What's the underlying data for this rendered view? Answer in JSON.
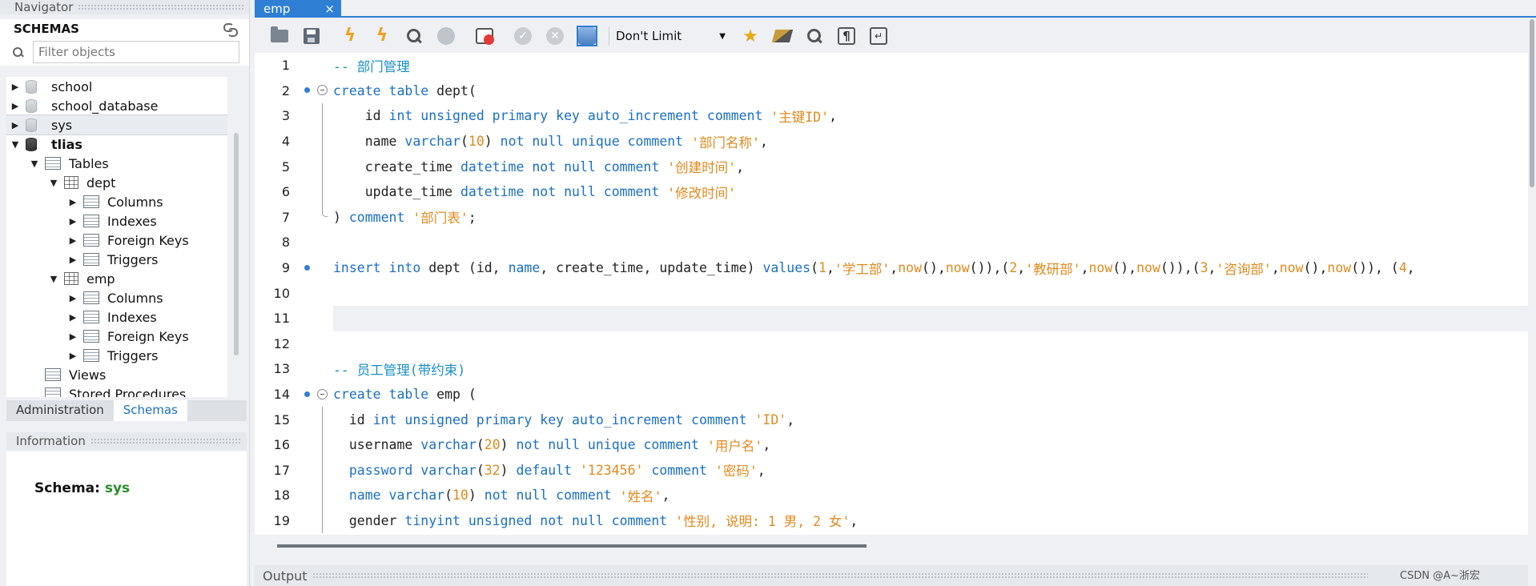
{
  "navigator": {
    "title": "Navigator",
    "schemas_title": "SCHEMAS",
    "filter_placeholder": "Filter objects",
    "tree": [
      {
        "label": "school",
        "level": 0,
        "toggle": "▶",
        "icon": "database-icon",
        "selected": false,
        "bold": false
      },
      {
        "label": "school_database",
        "level": 0,
        "toggle": "▶",
        "icon": "database-icon",
        "selected": false,
        "bold": false
      },
      {
        "label": "sys",
        "level": 0,
        "toggle": "▶",
        "icon": "database-icon",
        "selected": true,
        "bold": false
      },
      {
        "label": "tlias",
        "level": 0,
        "toggle": "▼",
        "icon": "database-icon-dark",
        "selected": false,
        "bold": true
      },
      {
        "label": "Tables",
        "level": 1,
        "toggle": "▼",
        "icon": "tables-folder-icon",
        "selected": false,
        "bold": false
      },
      {
        "label": "dept",
        "level": 2,
        "toggle": "▼",
        "icon": "table-icon",
        "selected": false,
        "bold": false
      },
      {
        "label": "Columns",
        "level": 3,
        "toggle": "▶",
        "icon": "columns-folder-icon",
        "selected": false,
        "bold": false
      },
      {
        "label": "Indexes",
        "level": 3,
        "toggle": "▶",
        "icon": "indexes-folder-icon",
        "selected": false,
        "bold": false
      },
      {
        "label": "Foreign Keys",
        "level": 3,
        "toggle": "▶",
        "icon": "foreign-keys-folder-icon",
        "selected": false,
        "bold": false
      },
      {
        "label": "Triggers",
        "level": 3,
        "toggle": "▶",
        "icon": "triggers-folder-icon",
        "selected": false,
        "bold": false
      },
      {
        "label": "emp",
        "level": 2,
        "toggle": "▼",
        "icon": "table-icon",
        "selected": false,
        "bold": false
      },
      {
        "label": "Columns",
        "level": 3,
        "toggle": "▶",
        "icon": "columns-folder-icon",
        "selected": false,
        "bold": false
      },
      {
        "label": "Indexes",
        "level": 3,
        "toggle": "▶",
        "icon": "indexes-folder-icon",
        "selected": false,
        "bold": false
      },
      {
        "label": "Foreign Keys",
        "level": 3,
        "toggle": "▶",
        "icon": "foreign-keys-folder-icon",
        "selected": false,
        "bold": false
      },
      {
        "label": "Triggers",
        "level": 3,
        "toggle": "▶",
        "icon": "triggers-folder-icon",
        "selected": false,
        "bold": false
      },
      {
        "label": "Views",
        "level": 1,
        "toggle": "",
        "icon": "views-folder-icon",
        "selected": false,
        "bold": false
      },
      {
        "label": "Stored Procedures",
        "level": 1,
        "toggle": "",
        "icon": "procedures-folder-icon",
        "selected": false,
        "bold": false
      }
    ],
    "tabs": {
      "administration": "Administration",
      "schemas": "Schemas"
    }
  },
  "information": {
    "title": "Information",
    "schema_label": "Schema:",
    "schema_value": "sys"
  },
  "editor": {
    "tab_label": "emp",
    "tab_close": "×",
    "limit_value": "Don't Limit",
    "toolbar_icons": [
      "open-folder-icon",
      "save-icon",
      "execute-bolt-icon",
      "execute-current-bolt-icon",
      "explain-magnifier-icon",
      "stop-icon",
      "toggle-error-icon",
      "commit-check-icon",
      "rollback-icon",
      "autocommit-icon",
      "limit-select",
      "add-snippet-star-icon",
      "beautify-brush-icon",
      "find-icon",
      "invisible-chars-icon",
      "wrap-lines-icon"
    ],
    "colors": {
      "keyword": "#1a6fc4",
      "string": "#e08a1e",
      "number": "#e08a1e",
      "comment": "#1a8fc4",
      "plain": "#222222",
      "accent": "#2f7fd4"
    },
    "lines": [
      {
        "n": "1",
        "marker": "",
        "fold": "",
        "tokens": [
          {
            "t": "-- 部门管理",
            "c": "comment"
          }
        ]
      },
      {
        "n": "2",
        "marker": "dot",
        "fold": "open",
        "tokens": [
          {
            "t": "create table",
            "c": "keyword"
          },
          {
            "t": " dept(",
            "c": "plain"
          }
        ]
      },
      {
        "n": "3",
        "marker": "",
        "fold": "line",
        "tokens": [
          {
            "t": "    id ",
            "c": "plain"
          },
          {
            "t": "int unsigned primary key auto_increment comment",
            "c": "keyword"
          },
          {
            "t": " ",
            "c": "plain"
          },
          {
            "t": "'主键ID'",
            "c": "string"
          },
          {
            "t": ",",
            "c": "plain"
          }
        ]
      },
      {
        "n": "4",
        "marker": "",
        "fold": "line",
        "tokens": [
          {
            "t": "    name ",
            "c": "plain"
          },
          {
            "t": "varchar",
            "c": "keyword"
          },
          {
            "t": "(",
            "c": "plain"
          },
          {
            "t": "10",
            "c": "number"
          },
          {
            "t": ") ",
            "c": "plain"
          },
          {
            "t": "not null unique comment",
            "c": "keyword"
          },
          {
            "t": " ",
            "c": "plain"
          },
          {
            "t": "'部门名称'",
            "c": "string"
          },
          {
            "t": ",",
            "c": "plain"
          }
        ]
      },
      {
        "n": "5",
        "marker": "",
        "fold": "line",
        "tokens": [
          {
            "t": "    create_time ",
            "c": "plain"
          },
          {
            "t": "datetime not null comment",
            "c": "keyword"
          },
          {
            "t": " ",
            "c": "plain"
          },
          {
            "t": "'创建时间'",
            "c": "string"
          },
          {
            "t": ",",
            "c": "plain"
          }
        ]
      },
      {
        "n": "6",
        "marker": "",
        "fold": "line",
        "tokens": [
          {
            "t": "    update_time ",
            "c": "plain"
          },
          {
            "t": "datetime not null comment",
            "c": "keyword"
          },
          {
            "t": " ",
            "c": "plain"
          },
          {
            "t": "'修改时间'",
            "c": "string"
          }
        ]
      },
      {
        "n": "7",
        "marker": "",
        "fold": "end",
        "tokens": [
          {
            "t": ") ",
            "c": "plain"
          },
          {
            "t": "comment",
            "c": "keyword"
          },
          {
            "t": " ",
            "c": "plain"
          },
          {
            "t": "'部门表'",
            "c": "string"
          },
          {
            "t": ";",
            "c": "plain"
          }
        ]
      },
      {
        "n": "8",
        "marker": "",
        "fold": "",
        "tokens": []
      },
      {
        "n": "9",
        "marker": "dot",
        "fold": "",
        "tokens": [
          {
            "t": "insert into",
            "c": "keyword"
          },
          {
            "t": " dept (id, ",
            "c": "plain"
          },
          {
            "t": "name",
            "c": "keyword"
          },
          {
            "t": ", create_time, update_time) ",
            "c": "plain"
          },
          {
            "t": "values",
            "c": "keyword"
          },
          {
            "t": "(",
            "c": "plain"
          },
          {
            "t": "1",
            "c": "number"
          },
          {
            "t": ",",
            "c": "plain"
          },
          {
            "t": "'学工部'",
            "c": "string"
          },
          {
            "t": ",",
            "c": "plain"
          },
          {
            "t": "now",
            "c": "number"
          },
          {
            "t": "(),",
            "c": "plain"
          },
          {
            "t": "now",
            "c": "number"
          },
          {
            "t": "()),(",
            "c": "plain"
          },
          {
            "t": "2",
            "c": "number"
          },
          {
            "t": ",",
            "c": "plain"
          },
          {
            "t": "'教研部'",
            "c": "string"
          },
          {
            "t": ",",
            "c": "plain"
          },
          {
            "t": "now",
            "c": "number"
          },
          {
            "t": "(),",
            "c": "plain"
          },
          {
            "t": "now",
            "c": "number"
          },
          {
            "t": "()),(",
            "c": "plain"
          },
          {
            "t": "3",
            "c": "number"
          },
          {
            "t": ",",
            "c": "plain"
          },
          {
            "t": "'咨询部'",
            "c": "string"
          },
          {
            "t": ",",
            "c": "plain"
          },
          {
            "t": "now",
            "c": "number"
          },
          {
            "t": "(),",
            "c": "plain"
          },
          {
            "t": "now",
            "c": "number"
          },
          {
            "t": "()), (",
            "c": "plain"
          },
          {
            "t": "4",
            "c": "number"
          },
          {
            "t": ",",
            "c": "plain"
          }
        ]
      },
      {
        "n": "10",
        "marker": "",
        "fold": "",
        "tokens": []
      },
      {
        "n": "11",
        "marker": "",
        "fold": "",
        "highlight": true,
        "tokens": []
      },
      {
        "n": "12",
        "marker": "",
        "fold": "",
        "tokens": []
      },
      {
        "n": "13",
        "marker": "",
        "fold": "",
        "tokens": [
          {
            "t": "-- 员工管理(带约束)",
            "c": "comment"
          }
        ]
      },
      {
        "n": "14",
        "marker": "dot",
        "fold": "open",
        "tokens": [
          {
            "t": "create table",
            "c": "keyword"
          },
          {
            "t": " emp (",
            "c": "plain"
          }
        ]
      },
      {
        "n": "15",
        "marker": "",
        "fold": "line",
        "tokens": [
          {
            "t": "  id ",
            "c": "plain"
          },
          {
            "t": "int unsigned primary key auto_increment comment",
            "c": "keyword"
          },
          {
            "t": " ",
            "c": "plain"
          },
          {
            "t": "'ID'",
            "c": "string"
          },
          {
            "t": ",",
            "c": "plain"
          }
        ]
      },
      {
        "n": "16",
        "marker": "",
        "fold": "line",
        "tokens": [
          {
            "t": "  username ",
            "c": "plain"
          },
          {
            "t": "varchar",
            "c": "keyword"
          },
          {
            "t": "(",
            "c": "plain"
          },
          {
            "t": "20",
            "c": "number"
          },
          {
            "t": ") ",
            "c": "plain"
          },
          {
            "t": "not null unique comment",
            "c": "keyword"
          },
          {
            "t": " ",
            "c": "plain"
          },
          {
            "t": "'用户名'",
            "c": "string"
          },
          {
            "t": ",",
            "c": "plain"
          }
        ]
      },
      {
        "n": "17",
        "marker": "",
        "fold": "line",
        "tokens": [
          {
            "t": "  password ",
            "c": "keyword"
          },
          {
            "t": "varchar",
            "c": "keyword"
          },
          {
            "t": "(",
            "c": "plain"
          },
          {
            "t": "32",
            "c": "number"
          },
          {
            "t": ") ",
            "c": "plain"
          },
          {
            "t": "default",
            "c": "keyword"
          },
          {
            "t": " ",
            "c": "plain"
          },
          {
            "t": "'123456'",
            "c": "string"
          },
          {
            "t": " ",
            "c": "plain"
          },
          {
            "t": "comment",
            "c": "keyword"
          },
          {
            "t": " ",
            "c": "plain"
          },
          {
            "t": "'密码'",
            "c": "string"
          },
          {
            "t": ",",
            "c": "plain"
          }
        ]
      },
      {
        "n": "18",
        "marker": "",
        "fold": "line",
        "tokens": [
          {
            "t": "  name ",
            "c": "keyword"
          },
          {
            "t": "varchar",
            "c": "keyword"
          },
          {
            "t": "(",
            "c": "plain"
          },
          {
            "t": "10",
            "c": "number"
          },
          {
            "t": ") ",
            "c": "plain"
          },
          {
            "t": "not null comment",
            "c": "keyword"
          },
          {
            "t": " ",
            "c": "plain"
          },
          {
            "t": "'姓名'",
            "c": "string"
          },
          {
            "t": ",",
            "c": "plain"
          }
        ]
      },
      {
        "n": "19",
        "marker": "",
        "fold": "line",
        "tokens": [
          {
            "t": "  gender ",
            "c": "plain"
          },
          {
            "t": "tinyint unsigned not null comment",
            "c": "keyword"
          },
          {
            "t": " ",
            "c": "plain"
          },
          {
            "t": "'性别, 说明: 1 男, 2 女'",
            "c": "string"
          },
          {
            "t": ",",
            "c": "plain"
          }
        ]
      }
    ]
  },
  "output": {
    "title": "Output"
  },
  "watermark": "CSDN @A~浙宏"
}
